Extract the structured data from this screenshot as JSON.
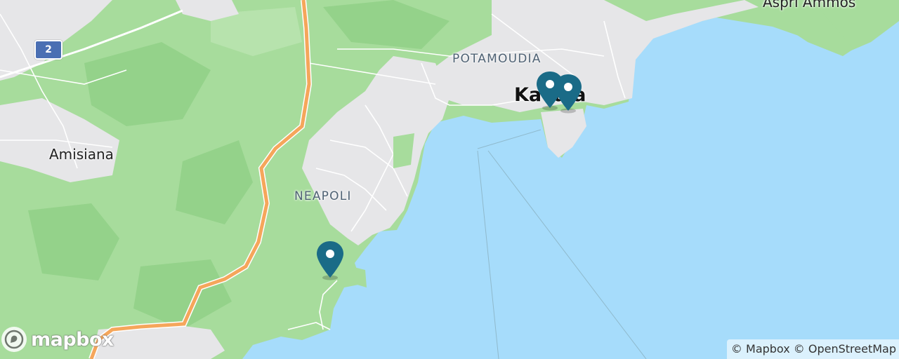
{
  "map": {
    "colors": {
      "water": "#a6dcfb",
      "forest": "#a7dc9c",
      "forest_dark": "#8fcf86",
      "urban": "#e6e6e8",
      "motorway": "#f5a65b",
      "marker": "#1a6b87"
    },
    "labels": {
      "potamoudia": "POTAMOUDIA",
      "kavala": "Kavala",
      "neapoli": "NEAPOLI",
      "amisiana": "Amisiana",
      "aspri_ammos": "Aspri Ammos"
    },
    "road_shield": "2",
    "markers": [
      {
        "name": "marker-1"
      },
      {
        "name": "marker-2"
      },
      {
        "name": "marker-3"
      }
    ]
  },
  "branding": {
    "logo_text": "mapbox",
    "logo_icon": "mapbox-logo-icon"
  },
  "attribution": {
    "mapbox": "© Mapbox",
    "osm": "© OpenStreetMap"
  }
}
